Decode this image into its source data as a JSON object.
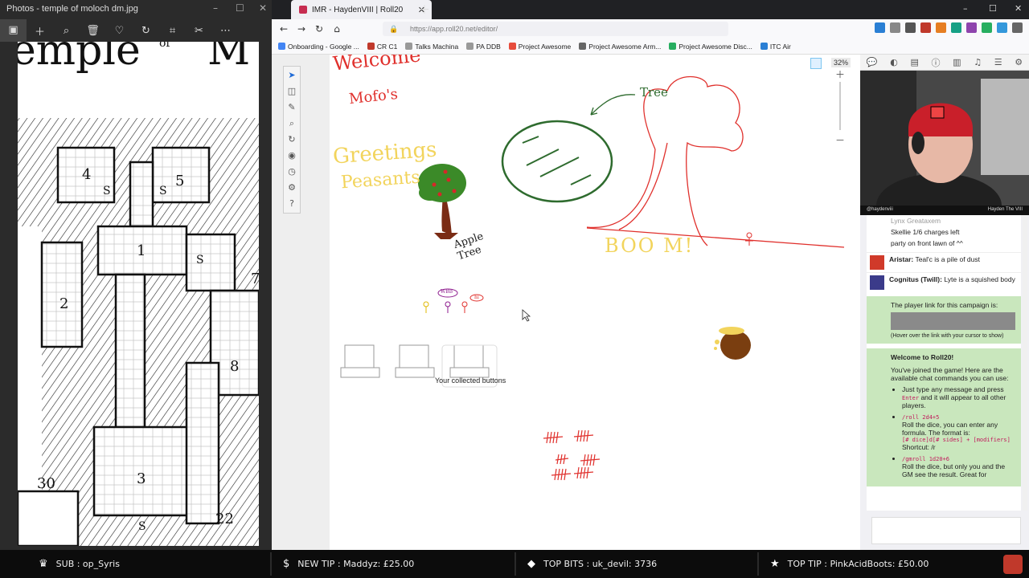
{
  "photos": {
    "title": "Photos - temple of moloch dm.jpg",
    "map_banner_text": "emple of M",
    "map_numbers": [
      "4",
      "5",
      "1",
      "2",
      "3",
      "8",
      "30",
      "22",
      "7"
    ],
    "map_letters": [
      "S",
      "S",
      "S",
      "S"
    ]
  },
  "browser": {
    "tab_title": "IMR - HaydenVIII | Roll20",
    "url": "https://app.roll20.net/editor/",
    "bookmarks": [
      "Onboarding - Google ...",
      "CR C1",
      "Talks Machina",
      "PA DDB",
      "Project Awesome",
      "Project Awesome Arm...",
      "Project Awesome Disc...",
      "ITC Air"
    ],
    "zoom": "32%"
  },
  "canvas": {
    "welcome": "Welcome",
    "mofos": "Mofo's",
    "greetings": "Greetings",
    "peasants": "Peasants",
    "apple_tree": "Apple Tree",
    "tree_label": "Tree",
    "boo": "BOO M!",
    "collected_buttons": "Your collected buttons",
    "bubble_1": "WBB",
    "bubble_2": "hi"
  },
  "cam": {
    "left_handle": "@haydenviii",
    "right_handle": "Hayden The VIII"
  },
  "chat": {
    "top_lines": [
      "Lynx Greataxem",
      "Skellie 1/6 charges left",
      "party on front lawn of ^^"
    ],
    "messages": [
      {
        "name": "Aristar:",
        "text": "Teal'c is a pile of dust"
      },
      {
        "name": "Cognitus (Twill):",
        "text": "Lyte is a squished body"
      }
    ],
    "player_link_label": "The player link for this campaign is:",
    "hover_note": "(Hover over the link with your cursor to show)",
    "welcome_title": "Welcome to Roll20!",
    "welcome_body": "You've joined the game! Here are the available chat commands you can use:",
    "bullet1_pre": "Just type any message and press",
    "bullet1_key": "Enter",
    "bullet1_post": "and it will appear to all other players.",
    "roll_cmd": "/roll 2d4+5",
    "roll_desc": "Roll the dice, you can enter any formula. The format is:",
    "roll_format": "[# dice]d[# sides] + [modifiers]",
    "shortcut": "Shortcut: /r",
    "gmroll_cmd": "/gmroll 1d20+6",
    "gmroll_desc": "Roll the dice, but only you and the GM see the result. Great for"
  },
  "overlay": {
    "sub": "SUB : op_Syris",
    "new_tip": "NEW TIP : Maddyz: £25.00",
    "top_bits": "TOP BITS : uk_devil: 3736",
    "top_tip": "TOP TIP : PinkAcidBoots: £50.00"
  },
  "colors": {
    "roll20_red": "#c62c50",
    "chat_green": "#c9e7bd",
    "overlay_bg": "#0c0c0c",
    "drawing_red": "#e0302c",
    "drawing_yellow": "#f2d45c",
    "drawing_green": "#2e6b2e",
    "drawing_purple": "#8d1a8d"
  }
}
